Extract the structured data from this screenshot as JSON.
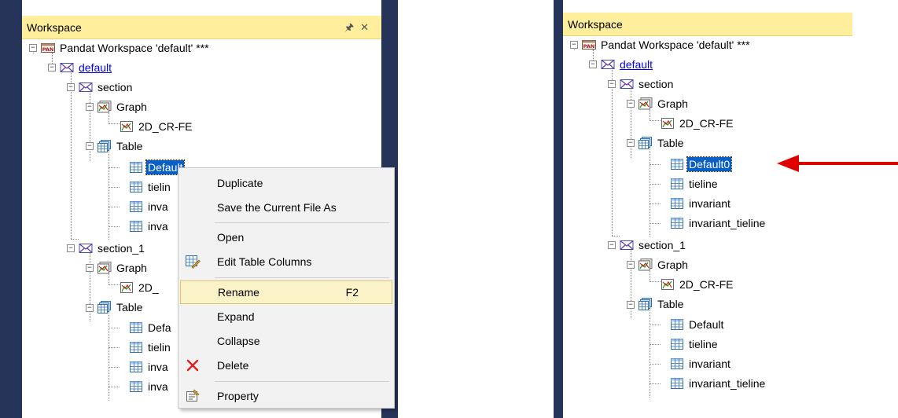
{
  "left": {
    "title": "Workspace",
    "pin_icon": "pin-icon",
    "close_icon": "close-icon",
    "tree": {
      "root": "Pandat Workspace 'default' ***",
      "default": "default",
      "section": "section",
      "graph": "Graph",
      "graph_item": "2D_CR-FE",
      "table": "Table",
      "tables": [
        "Default",
        "tieline",
        "invariant",
        "invariant_tieline"
      ],
      "section_1": "section_1",
      "graph_1": "Graph",
      "graph_item_1": "2D_CR-FE",
      "table_1": "Table",
      "tables_1": [
        "Default",
        "tieline",
        "invariant",
        "invariant_tieline"
      ]
    },
    "truncated": {
      "t1": "tielin",
      "t2": "inva",
      "t3": "inva",
      "g1": "2D_",
      "s1_t0": "Defa",
      "s1_t1": "tielin",
      "s1_t2": "inva",
      "s1_t3": "inva"
    },
    "context_menu": {
      "items": [
        {
          "label": "Duplicate"
        },
        {
          "label": "Save the Current File As"
        },
        {
          "label": "Open"
        },
        {
          "label": "Edit Table Columns"
        },
        {
          "label": "Rename",
          "shortcut": "F2",
          "highlighted": true
        },
        {
          "label": "Expand"
        },
        {
          "label": "Collapse"
        },
        {
          "label": "Delete"
        },
        {
          "label": "Property"
        }
      ]
    }
  },
  "right": {
    "title": "Workspace",
    "tree": {
      "root": "Pandat Workspace 'default' ***",
      "default": "default",
      "section": "section",
      "graph": "Graph",
      "graph_item": "2D_CR-FE",
      "table": "Table",
      "tables": [
        "Default0",
        "tieline",
        "invariant",
        "invariant_tieline"
      ],
      "section_1": "section_1",
      "graph_1": "Graph",
      "graph_item_1": "2D_CR-FE",
      "table_1": "Table",
      "tables_1": [
        "Default",
        "tieline",
        "invariant",
        "invariant_tieline"
      ]
    }
  },
  "annotation": {
    "arrow_color": "#e00000"
  }
}
